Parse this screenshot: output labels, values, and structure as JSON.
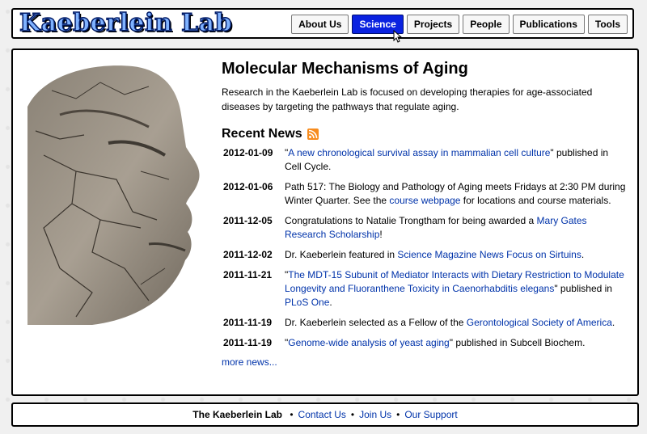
{
  "header": {
    "logo_text": "Kaeberlein Lab",
    "nav": [
      {
        "label": "About Us"
      },
      {
        "label": "Science",
        "active": true
      },
      {
        "label": "Projects"
      },
      {
        "label": "People"
      },
      {
        "label": "Publications"
      },
      {
        "label": "Tools"
      }
    ]
  },
  "main": {
    "title": "Molecular Mechanisms of Aging",
    "intro": "Research in the Kaeberlein Lab is focused on developing therapies for age-associated diseases by targeting the pathways that regulate aging.",
    "news_heading": "Recent News",
    "news": [
      {
        "date": "2012-01-09",
        "parts": [
          {
            "t": "\""
          },
          {
            "t": "A new chronological survival assay in mammalian cell culture",
            "link": true
          },
          {
            "t": "\" published in Cell Cycle."
          }
        ]
      },
      {
        "date": "2012-01-06",
        "parts": [
          {
            "t": "Path 517: The Biology and Pathology of Aging meets Fridays at 2:30 PM during Winter Quarter.  See the "
          },
          {
            "t": "course webpage",
            "link": true
          },
          {
            "t": " for locations and course materials."
          }
        ]
      },
      {
        "date": "2011-12-05",
        "parts": [
          {
            "t": "Congratulations to Natalie Trongtham for being awarded a "
          },
          {
            "t": "Mary Gates Research Scholarship",
            "link": true
          },
          {
            "t": "!"
          }
        ]
      },
      {
        "date": "2011-12-02",
        "parts": [
          {
            "t": "Dr. Kaeberlein featured in "
          },
          {
            "t": "Science Magazine News Focus on Sirtuins",
            "link": true
          },
          {
            "t": "."
          }
        ]
      },
      {
        "date": "2011-11-21",
        "parts": [
          {
            "t": "\""
          },
          {
            "t": "The MDT-15 Subunit of Mediator Interacts with Dietary Restriction to Modulate Longevity and Fluoranthene Toxicity in Caenorhabditis elegans",
            "link": true
          },
          {
            "t": "\" published in "
          },
          {
            "t": "PLoS One",
            "link": true
          },
          {
            "t": "."
          }
        ]
      },
      {
        "date": "2011-11-19",
        "parts": [
          {
            "t": "Dr. Kaeberlein selected as a Fellow of the "
          },
          {
            "t": "Gerontological Society of America",
            "link": true
          },
          {
            "t": "."
          }
        ]
      },
      {
        "date": "2011-11-19",
        "parts": [
          {
            "t": "\""
          },
          {
            "t": "Genome-wide analysis of yeast aging",
            "link": true
          },
          {
            "t": "\" published in Subcell Biochem."
          }
        ]
      }
    ],
    "more_news": "more news..."
  },
  "footer": {
    "name": "The Kaeberlein Lab",
    "separator": "•",
    "links": [
      "Contact Us",
      "Join Us",
      "Our Support"
    ]
  },
  "colors": {
    "accent": "#0a22e0",
    "link": "#0033aa",
    "rss": "#f78c1e"
  }
}
